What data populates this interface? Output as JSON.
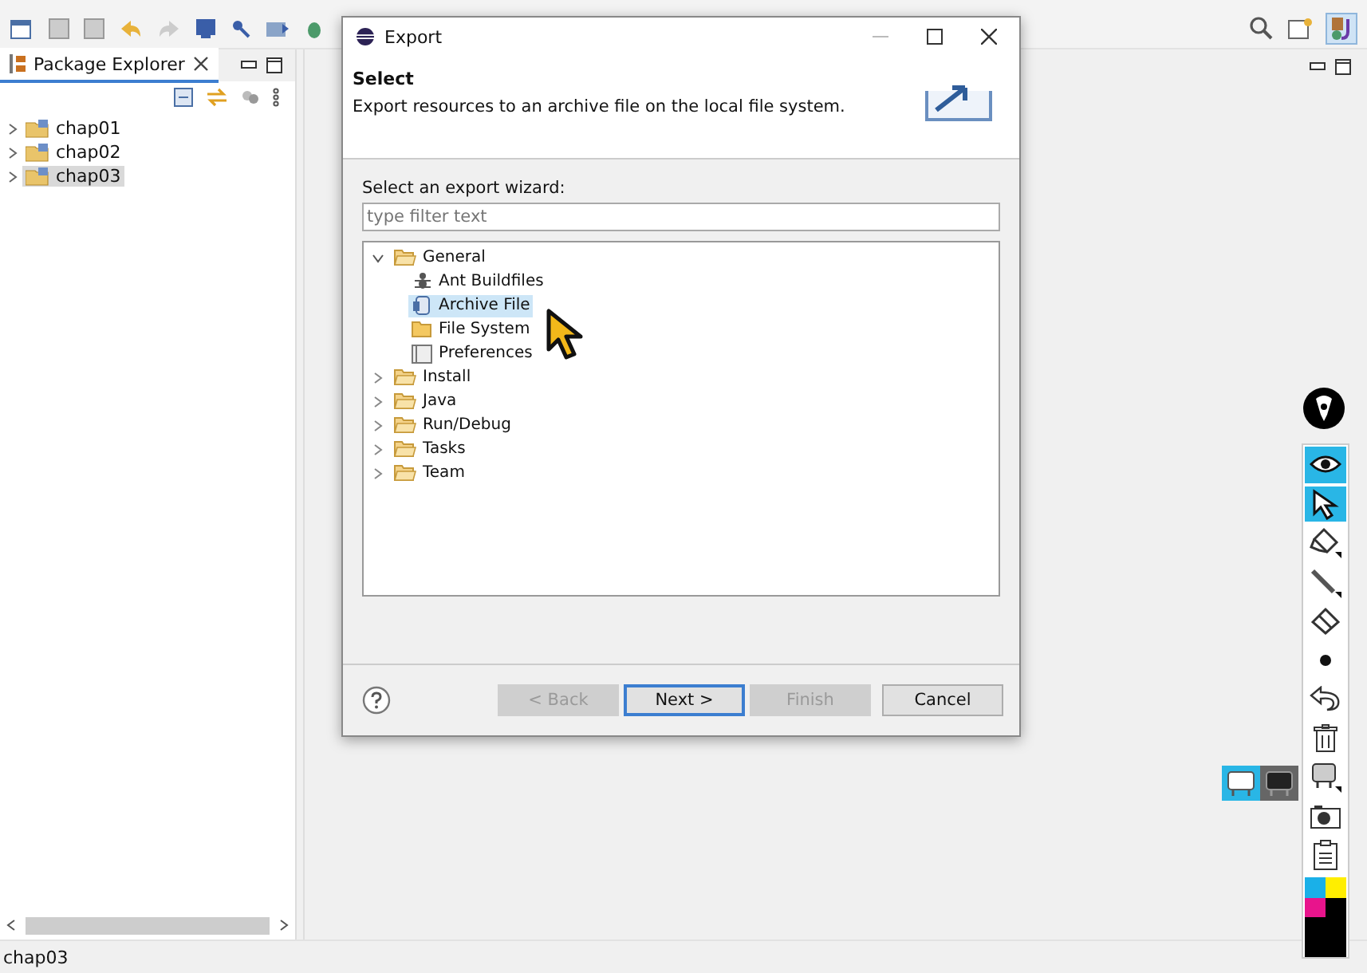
{
  "package_explorer": {
    "title": "Package Explorer",
    "projects": [
      {
        "name": "chap01",
        "selected": false
      },
      {
        "name": "chap02",
        "selected": false
      },
      {
        "name": "chap03",
        "selected": true
      }
    ]
  },
  "dialog": {
    "title": "Export",
    "heading": "Select",
    "description": "Export resources to an archive file on the local file system.",
    "wizard_label": "Select an export wizard:",
    "filter": {
      "placeholder": "type filter text"
    },
    "tree": [
      {
        "label": "General",
        "expanded": true,
        "children": [
          {
            "label": "Ant Buildfiles",
            "kind": "ant",
            "selected": false
          },
          {
            "label": "Archive File",
            "kind": "archive",
            "selected": true
          },
          {
            "label": "File System",
            "kind": "folder",
            "selected": false
          },
          {
            "label": "Preferences",
            "kind": "preferences",
            "selected": false
          }
        ]
      },
      {
        "label": "Install",
        "expanded": false
      },
      {
        "label": "Java",
        "expanded": false
      },
      {
        "label": "Run/Debug",
        "expanded": false
      },
      {
        "label": "Tasks",
        "expanded": false
      },
      {
        "label": "Team",
        "expanded": false
      }
    ],
    "buttons": [
      {
        "label": "< Back",
        "disabled": true,
        "default": false
      },
      {
        "label": "Next >",
        "disabled": false,
        "default": true
      },
      {
        "label": "Finish",
        "disabled": true,
        "default": false
      },
      {
        "label": "Cancel",
        "disabled": false,
        "default": false
      }
    ]
  },
  "annotation_tools": [
    {
      "kind": "eye",
      "selected": true
    },
    {
      "kind": "pointer",
      "selected": true
    },
    {
      "kind": "marker",
      "selected": false
    },
    {
      "kind": "line",
      "selected": false
    },
    {
      "kind": "eraser",
      "selected": false
    },
    {
      "kind": "dot",
      "selected": false
    },
    {
      "kind": "undo",
      "selected": false
    },
    {
      "kind": "trash",
      "selected": false
    },
    {
      "kind": "board",
      "selected": false
    },
    {
      "kind": "camera",
      "selected": false
    },
    {
      "kind": "clipboard",
      "selected": false
    }
  ],
  "status_bar": {
    "text": "chap03"
  }
}
